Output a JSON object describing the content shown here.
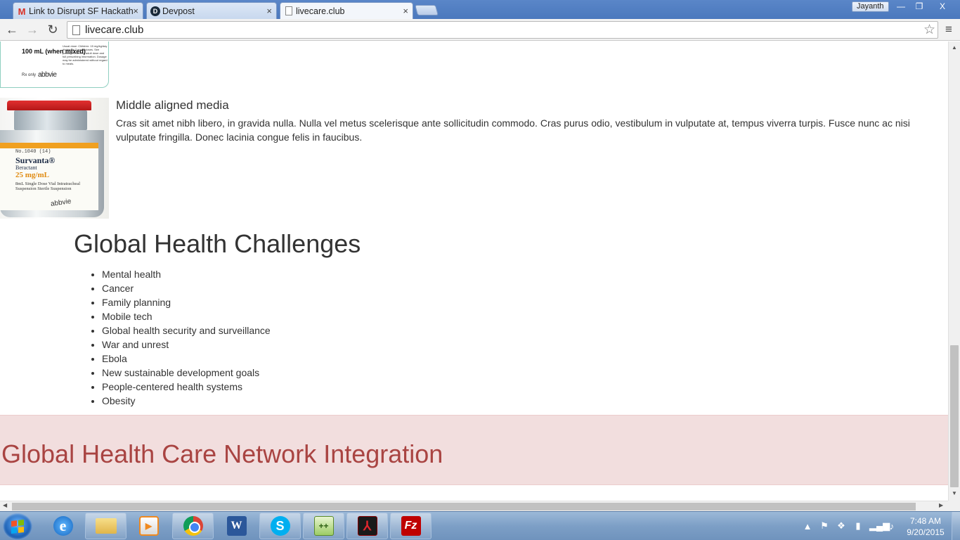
{
  "browser": {
    "tabs": [
      {
        "title": "Link to Disrupt SF Hackath",
        "favicon": "gmail-icon",
        "active": false
      },
      {
        "title": "Devpost",
        "favicon": "devpost-icon",
        "active": false
      },
      {
        "title": "livecare.club",
        "favicon": "page-icon",
        "active": true
      }
    ],
    "close_glyph": "×",
    "user": "Jayanth",
    "url": "livecare.club",
    "window_buttons": {
      "minimize": "—",
      "maximize": "❐",
      "close": "X"
    }
  },
  "page": {
    "top_image": {
      "volume_label": "100 mL (when mixed)",
      "fine_print": "Usual dose: Children: 15 mg/kg/day divided in 2 equal doses. See package insert for adult dose and full prescribing information. Dosage may be administered without regard to meals.",
      "rx_label": "Rx only",
      "brand": "abbvie"
    },
    "vial_image": {
      "code": "No.1040 (14)",
      "rx": "Rx",
      "name": "Survanta®",
      "subname": "Beractant",
      "strength": "25 mg/mL",
      "description": "8mL Single Dose Vial Intratracheal Suspension Sterile Suspension",
      "brand": "abbvie"
    },
    "media": {
      "heading": "Middle aligned media",
      "body": "Cras sit amet nibh libero, in gravida nulla. Nulla vel metus scelerisque ante sollicitudin commodo. Cras purus odio, vestibulum in vulputate at, tempus viverra turpis. Fusce nunc ac nisi vulputate fringilla. Donec lacinia congue felis in faucibus."
    },
    "challenges": {
      "title": "Global Health Challenges",
      "items": [
        "Mental health",
        "Cancer",
        "Family planning",
        "Mobile tech",
        "Global health security and surveillance",
        "War and unrest",
        "Ebola",
        "New sustainable development goals",
        "People-centered health systems",
        "Obesity"
      ]
    },
    "band": {
      "title": "Global Health Care Network Integration"
    }
  },
  "taskbar": {
    "clock_time": "7:48 AM",
    "clock_date": "9/20/2015",
    "apps": [
      "internet-explorer-icon",
      "folder-icon",
      "media-player-icon",
      "chrome-icon",
      "word-icon",
      "skype-icon",
      "notepad-plus-icon",
      "acrobat-icon",
      "filezilla-icon"
    ]
  },
  "colors": {
    "band_bg": "#f2dede",
    "band_text": "#a94442",
    "body_text": "#333333",
    "taskbar": "#7d9fc6"
  }
}
